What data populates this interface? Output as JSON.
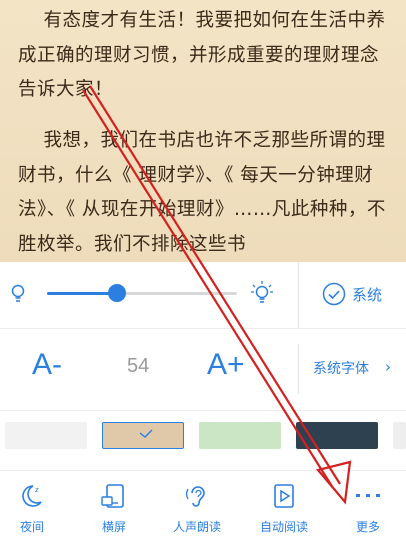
{
  "reader": {
    "paragraph1": "    有态度才有生活！我要把如何在生活中养成正确的理财习惯，并形成重要的理财理念告诉大家！",
    "paragraph2": "    我想，我们在书店也许不乏那些所谓的理财书，什么《 理财学》、《 每天一分钟理财法》、《 从现在开始理财》……凡此种种，不胜枚举。我们不排除这些书"
  },
  "brightness": {
    "level": 0.37,
    "system_label": "系统"
  },
  "font": {
    "decrease_label": "A-",
    "size_value": "54",
    "increase_label": "A+",
    "family_label": "系统字体",
    "chevron": "›"
  },
  "themes": {
    "selected": "tan",
    "items": [
      {
        "name": "white",
        "color": "#f2f2f2"
      },
      {
        "name": "tan",
        "color": "#dfc9a8"
      },
      {
        "name": "green",
        "color": "#cbe6c5"
      },
      {
        "name": "dark",
        "color": "#2d4150"
      }
    ]
  },
  "toolbar": {
    "night": "夜间",
    "landscape": "横屏",
    "tts": "人声朗读",
    "autoread": "自动阅读",
    "more": "更多"
  },
  "colors": {
    "accent": "#2b7fe0",
    "annotation_arrow": "#d42020"
  }
}
